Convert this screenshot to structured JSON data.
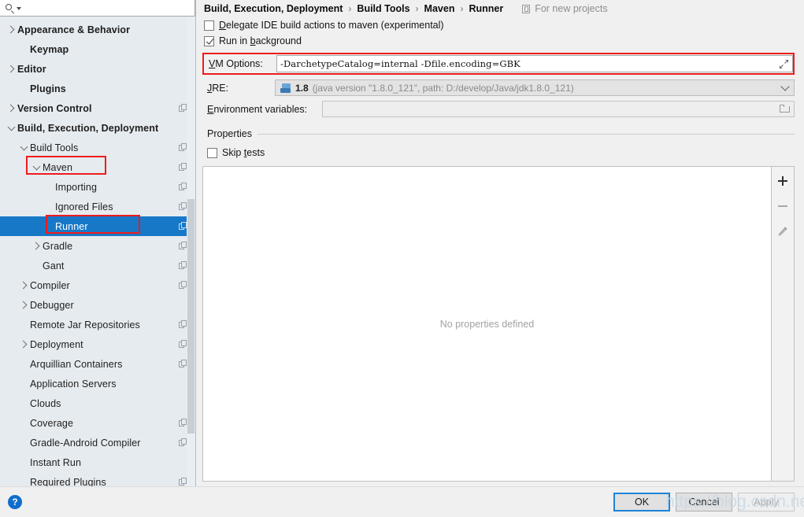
{
  "search": {
    "placeholder": "",
    "value": "",
    "icon": "search-icon"
  },
  "sidebar": {
    "items": [
      {
        "label": "Appearance & Behavior",
        "indent": 0,
        "arrow": "right",
        "bold": true,
        "cfg": false,
        "selected": false
      },
      {
        "label": "Keymap",
        "indent": 1,
        "arrow": "none",
        "bold": true,
        "cfg": false,
        "selected": false
      },
      {
        "label": "Editor",
        "indent": 0,
        "arrow": "right",
        "bold": true,
        "cfg": false,
        "selected": false
      },
      {
        "label": "Plugins",
        "indent": 1,
        "arrow": "none",
        "bold": true,
        "cfg": false,
        "selected": false
      },
      {
        "label": "Version Control",
        "indent": 0,
        "arrow": "right",
        "bold": true,
        "cfg": true,
        "selected": false
      },
      {
        "label": "Build, Execution, Deployment",
        "indent": 0,
        "arrow": "down",
        "bold": true,
        "cfg": false,
        "selected": false
      },
      {
        "label": "Build Tools",
        "indent": 1,
        "arrow": "down",
        "bold": false,
        "cfg": true,
        "selected": false
      },
      {
        "label": "Maven",
        "indent": 2,
        "arrow": "down",
        "bold": false,
        "cfg": true,
        "selected": false
      },
      {
        "label": "Importing",
        "indent": 3,
        "arrow": "none",
        "bold": false,
        "cfg": true,
        "selected": false
      },
      {
        "label": "Ignored Files",
        "indent": 3,
        "arrow": "none",
        "bold": false,
        "cfg": true,
        "selected": false
      },
      {
        "label": "Runner",
        "indent": 3,
        "arrow": "none",
        "bold": false,
        "cfg": true,
        "selected": true
      },
      {
        "label": "Gradle",
        "indent": 2,
        "arrow": "right",
        "bold": false,
        "cfg": true,
        "selected": false
      },
      {
        "label": "Gant",
        "indent": 2,
        "arrow": "none",
        "bold": false,
        "cfg": true,
        "selected": false
      },
      {
        "label": "Compiler",
        "indent": 1,
        "arrow": "right",
        "bold": false,
        "cfg": true,
        "selected": false
      },
      {
        "label": "Debugger",
        "indent": 1,
        "arrow": "right",
        "bold": false,
        "cfg": false,
        "selected": false
      },
      {
        "label": "Remote Jar Repositories",
        "indent": 1,
        "arrow": "none",
        "bold": false,
        "cfg": true,
        "selected": false
      },
      {
        "label": "Deployment",
        "indent": 1,
        "arrow": "right",
        "bold": false,
        "cfg": true,
        "selected": false
      },
      {
        "label": "Arquillian Containers",
        "indent": 1,
        "arrow": "none",
        "bold": false,
        "cfg": true,
        "selected": false
      },
      {
        "label": "Application Servers",
        "indent": 1,
        "arrow": "none",
        "bold": false,
        "cfg": false,
        "selected": false
      },
      {
        "label": "Clouds",
        "indent": 1,
        "arrow": "none",
        "bold": false,
        "cfg": false,
        "selected": false
      },
      {
        "label": "Coverage",
        "indent": 1,
        "arrow": "none",
        "bold": false,
        "cfg": true,
        "selected": false
      },
      {
        "label": "Gradle-Android Compiler",
        "indent": 1,
        "arrow": "none",
        "bold": false,
        "cfg": true,
        "selected": false
      },
      {
        "label": "Instant Run",
        "indent": 1,
        "arrow": "none",
        "bold": false,
        "cfg": false,
        "selected": false
      },
      {
        "label": "Required Plugins",
        "indent": 1,
        "arrow": "none",
        "bold": false,
        "cfg": true,
        "selected": false
      }
    ]
  },
  "breadcrumb": {
    "crumbs": [
      "Build, Execution, Deployment",
      "Build Tools",
      "Maven",
      "Runner"
    ],
    "separator": "›",
    "for_new_projects": "For new projects"
  },
  "form": {
    "delegate_label": "Delegate IDE build actions to maven (experimental)",
    "delegate_checked": false,
    "run_background_label": "Run in background",
    "run_background_checked": true,
    "vm_options_label": "VM Options:",
    "vm_options_value": "-DarchetypeCatalog=internal -Dfile.encoding=GBK",
    "jre_label": "JRE:",
    "jre_version": "1.8",
    "jre_description": "(java version \"1.8.0_121\", path: D:/develop/Java/jdk1.8.0_121)",
    "env_label": "Environment variables:",
    "env_value": "",
    "properties_section": "Properties",
    "skip_tests_label": "Skip tests",
    "skip_tests_checked": false,
    "no_properties_text": "No properties defined"
  },
  "toolbar": {
    "add_icon": "plus-icon",
    "remove_icon": "minus-icon",
    "edit_icon": "pencil-icon"
  },
  "footer": {
    "help_glyph": "?",
    "ok_label": "OK",
    "cancel_label": "Cancel",
    "apply_label": "Apply",
    "watermark": "https://blog.csdn.net/Naker"
  },
  "colors": {
    "selection_blue": "#1878c8",
    "annotation_red": "#ee1c1c",
    "sidebar_bg": "#e6ebef",
    "panel_bg": "#f0f0f0",
    "help_blue": "#0f6ecd"
  }
}
